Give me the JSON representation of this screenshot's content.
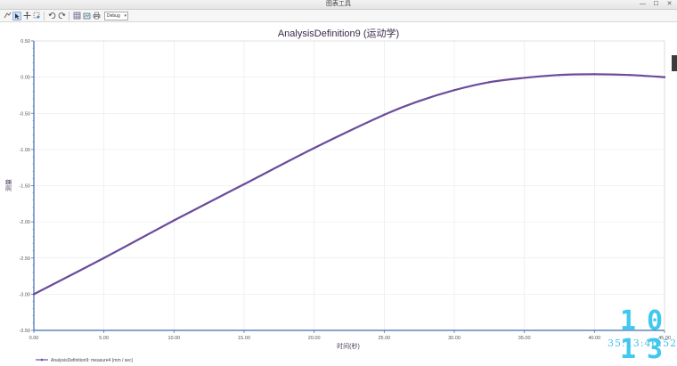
{
  "window": {
    "title": "图表工具",
    "minimize_glyph": "—",
    "maximize_glyph": "☐",
    "close_glyph": "✕"
  },
  "toolbar": {
    "icons": [
      "open-icon",
      "cursor-icon",
      "pan-icon",
      "zoom-icon",
      "undo-icon",
      "redo-icon",
      "grid-icon",
      "export-icon",
      "print-icon"
    ],
    "mode_select_value": "Debug"
  },
  "chart_data": {
    "type": "line",
    "title": "AnalysisDefinition9 (运动学)",
    "xlabel": "时间(秒)",
    "ylabel": "测量",
    "xlim": [
      0,
      45
    ],
    "ylim": [
      -3.5,
      0.5
    ],
    "x_ticks": [
      "0.00",
      "5.00",
      "10.00",
      "15.00",
      "20.00",
      "25.00",
      "30.00",
      "35.00",
      "40.00",
      "45.00"
    ],
    "y_ticks": [
      "0.50",
      "0.00",
      "-0.50",
      "-1.00",
      "-1.50",
      "-2.00",
      "-2.50",
      "-3.00",
      "-3.50"
    ],
    "grid": true,
    "legend": "bottom-left",
    "series": [
      {
        "name": "AnalysisDefinition9: measure4 (mm / sec)",
        "color": "#6a4c9c",
        "x": [
          0,
          5,
          10,
          15,
          20,
          25,
          27.5,
          30,
          32.5,
          35,
          37.5,
          40,
          42.5,
          45
        ],
        "y": [
          -3.0,
          -2.5,
          -1.98,
          -1.48,
          -0.98,
          -0.52,
          -0.33,
          -0.18,
          -0.07,
          -0.01,
          0.03,
          0.04,
          0.03,
          0.0
        ]
      }
    ]
  },
  "clock": {
    "big_digits": "10 13",
    "time_text": "35:13:46:52"
  }
}
